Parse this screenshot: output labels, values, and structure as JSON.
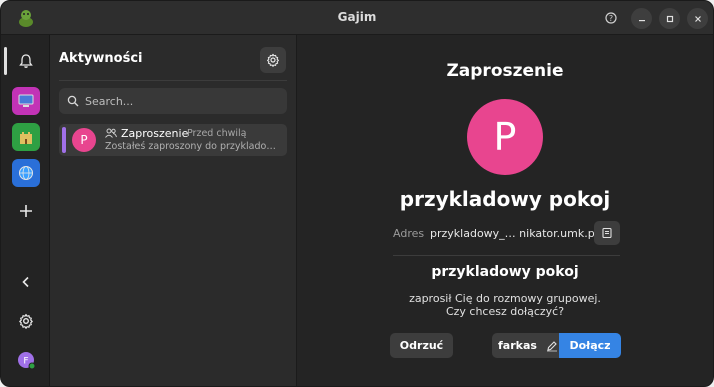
{
  "window": {
    "title": "Gajim"
  },
  "titlebar": {
    "help_icon": "help-circle-icon",
    "minimize_icon": "minimize-icon",
    "maximize_icon": "maximize-icon",
    "close_icon": "close-icon"
  },
  "rail": {
    "items": [
      {
        "icon": "bell-icon",
        "selected": true
      },
      {
        "icon": "workspace-monitor-icon",
        "color": "#c233b6"
      },
      {
        "icon": "workspace-castle-icon",
        "color": "#2ea043"
      },
      {
        "icon": "workspace-globe-icon",
        "color": "#2a6fd8"
      },
      {
        "icon": "plus-icon"
      }
    ],
    "bottom": [
      {
        "icon": "chevron-left-icon"
      },
      {
        "icon": "gear-icon"
      },
      {
        "icon": "account-avatar",
        "letter": "F",
        "color": "#a070e8",
        "status_color": "#2ea043"
      }
    ]
  },
  "activities": {
    "title": "Aktywności",
    "search_placeholder": "Search...",
    "items": [
      {
        "avatar_letter": "P",
        "avatar_color": "#e8458f",
        "title": "Zaproszenie",
        "time": "Przed chwilą",
        "subtitle": "Zostałeś zaproszony do przykladowy pokoj"
      }
    ]
  },
  "invitation": {
    "heading": "Zaproszenie",
    "avatar_letter": "P",
    "avatar_color": "#e8458f",
    "room_name": "przykladowy pokoj",
    "address_label": "Adres",
    "address_value": "przykladowy_… nikator.umk.pl",
    "room_name_small": "przykladowy pokoj",
    "message_line1": "zaprosił Cię do rozmowy grupowej.",
    "message_line2": "Czy chcesz dołączyć?",
    "decline_label": "Odrzuć",
    "nickname": "farkas",
    "join_label": "Dołącz"
  },
  "colors": {
    "accent": "#3584e4",
    "background": "#242424",
    "panel": "#2b2b2b"
  }
}
